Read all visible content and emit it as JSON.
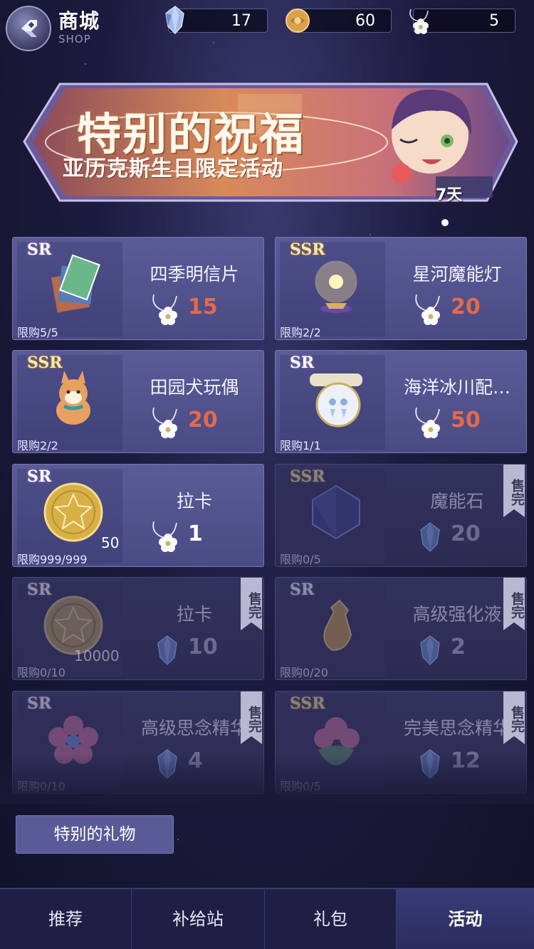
{
  "header": {
    "title": "商城",
    "subtitle": "SHOP",
    "currencies": [
      {
        "icon": "crystal-icon",
        "value": "17"
      },
      {
        "icon": "coin-icon",
        "value": "60"
      },
      {
        "icon": "flower-pendant-icon",
        "value": "5"
      }
    ]
  },
  "banner": {
    "title": "特别的祝福",
    "subtitle": "亚历克斯生日限定活动",
    "days_left": "7天"
  },
  "items": [
    {
      "rarity": "SR",
      "name": "四季明信片",
      "price": "15",
      "currency": "flower-pendant-icon",
      "limit": "限购5/5",
      "sold_out": false
    },
    {
      "rarity": "SSR",
      "name": "星河魔能灯",
      "price": "20",
      "currency": "flower-pendant-icon",
      "limit": "限购2/2",
      "sold_out": false
    },
    {
      "rarity": "SSR",
      "name": "田园犬玩偶",
      "price": "20",
      "currency": "flower-pendant-icon",
      "limit": "限购2/2",
      "sold_out": false
    },
    {
      "rarity": "SR",
      "name": "海洋冰川配…",
      "price": "50",
      "currency": "flower-pendant-icon",
      "limit": "限购1/1",
      "sold_out": false
    },
    {
      "rarity": "SR",
      "name": "拉卡",
      "price": "1",
      "currency": "flower-pendant-icon",
      "limit": "限购999/999",
      "quantity": "50",
      "sold_out": false
    },
    {
      "rarity": "SSR",
      "name": "魔能石",
      "price": "20",
      "currency": "crystal-icon",
      "limit": "限购0/5",
      "sold_out": true
    },
    {
      "rarity": "SR",
      "name": "拉卡",
      "price": "10",
      "currency": "crystal-icon",
      "limit": "限购0/10",
      "quantity": "10000",
      "sold_out": true
    },
    {
      "rarity": "SR",
      "name": "高级强化液",
      "price": "2",
      "currency": "crystal-icon",
      "limit": "限购0/20",
      "sold_out": true
    },
    {
      "rarity": "SR",
      "name": "高级思念精华",
      "price": "4",
      "currency": "crystal-icon",
      "limit": "限购0/10",
      "sold_out": true
    },
    {
      "rarity": "SSR",
      "name": "完美思念精华",
      "price": "12",
      "currency": "crystal-icon",
      "limit": "限购0/5",
      "sold_out": true
    }
  ],
  "sold_out_label": "售完",
  "special_gift_label": "特别的礼物",
  "tabs": [
    "推荐",
    "补给站",
    "礼包",
    "活动"
  ],
  "active_tab": "活动"
}
